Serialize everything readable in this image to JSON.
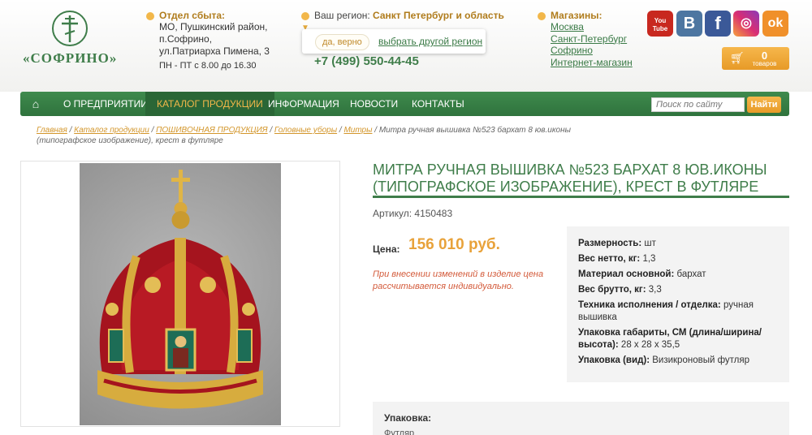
{
  "header": {
    "brand": "«СОФРИНО»",
    "sales": {
      "title": "Отдел сбыта:",
      "lines": [
        "МО, Пушкинский район,",
        "п.Софрино,",
        "ул.Патриарха Пимена, 3"
      ],
      "hours": "ПН - ПТ с 8.00 до 16.30"
    },
    "region": {
      "label": "Ваш регион:",
      "value": "Санкт Петербург и область",
      "confirm_label": "да, верно",
      "other_label": "выбрать другой регион",
      "phone": "+7 (499) 550-44-45"
    },
    "shops": {
      "title": "Магазины:",
      "items": [
        "Москва",
        "Санкт-Петербург",
        "Софрино",
        "Интернет-магазин"
      ]
    },
    "socials": {
      "youtube": "You Tube",
      "vk": "B",
      "facebook": "f",
      "instagram": "◎",
      "ok": "ok"
    },
    "cart": {
      "count": "0",
      "label": "товаров"
    }
  },
  "nav": {
    "items": [
      "О ПРЕДПРИЯТИИ",
      "КАТАЛОГ ПРОДУКЦИИ",
      "ИНФОРМАЦИЯ",
      "НОВОСТИ",
      "КОНТАКТЫ"
    ],
    "search_placeholder": "Поиск по сайту",
    "search_button": "Найти"
  },
  "breadcrumb": {
    "links": [
      "Главная",
      "Каталог продукции",
      "ПОШИВОЧНАЯ ПРОДУКЦИЯ",
      "Головные уборы",
      "Митры"
    ],
    "current": "Митра ручная вышивка №523 бархат 8 юв.иконы (типографское изображение), крест в футляре"
  },
  "product": {
    "title": "МИТРА РУЧНАЯ ВЫШИВКА №523 БАРХАТ 8 ЮВ.ИКОНЫ (ТИПОГРАФСКОЕ ИЗОБРАЖЕНИЕ), КРЕСТ В ФУТЛЯРЕ",
    "sku": "Артикул: 4150483",
    "price_label": "Цена:",
    "price": "156 010 руб.",
    "price_note": "При внесении изменений в изделие цена рассчитывается индивидуально.",
    "specs": [
      {
        "name": "Размерность:",
        "value": "шт"
      },
      {
        "name": "Вес нетто, кг:",
        "value": "1,3"
      },
      {
        "name": "Материал основной:",
        "value": "бархат"
      },
      {
        "name": "Вес брутто, кг:",
        "value": "3,3"
      },
      {
        "name": "Техника исполнения / отделка:",
        "value": "ручная вышивка"
      },
      {
        "name": "Упаковка габариты, СМ (длина/ширина/высота):",
        "value": "28 x 28 x 35,5"
      },
      {
        "name": "Упаковка (вид):",
        "value": "Визикроновый футляр"
      }
    ],
    "packaging_title": "Упаковка:",
    "packaging_value": "Футляр"
  },
  "colors": {
    "brand_green": "#3f7d4a",
    "accent_orange": "#e8a23a",
    "note_red": "#d35a3a"
  }
}
